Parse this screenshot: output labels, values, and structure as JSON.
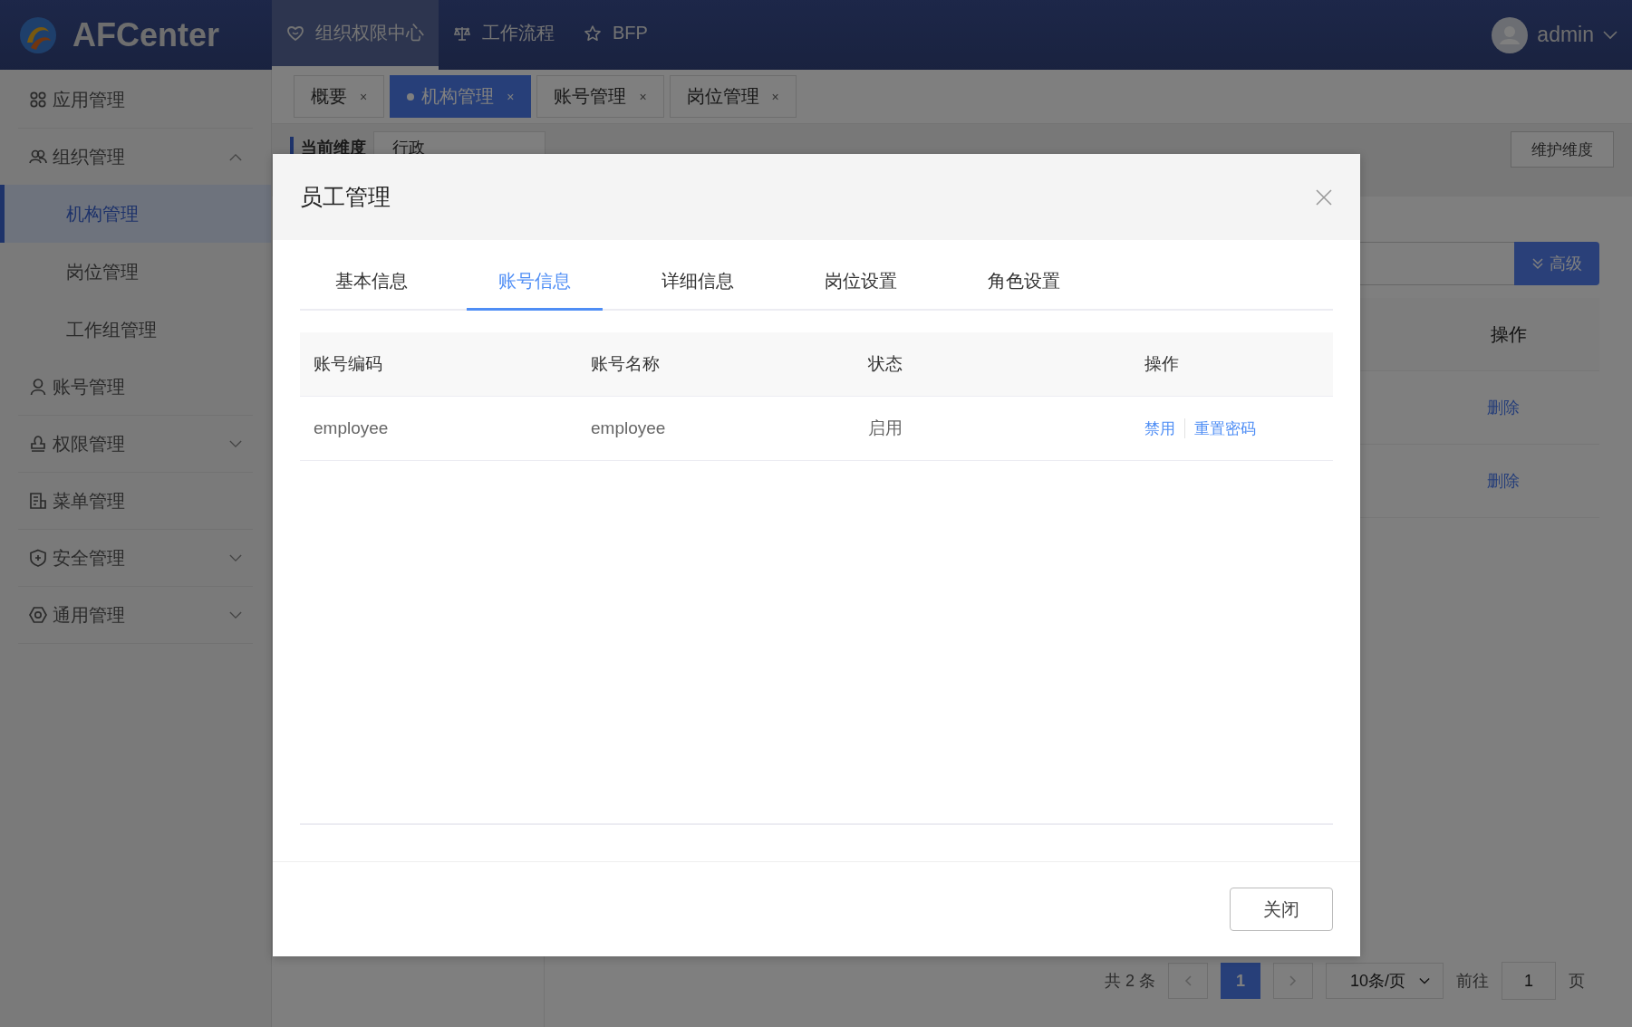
{
  "header": {
    "logo": "AFCenter",
    "nav": [
      {
        "label": "组织权限中心",
        "selected": true
      },
      {
        "label": "工作流程",
        "selected": false
      },
      {
        "label": "BFP",
        "selected": false
      }
    ],
    "user": "admin"
  },
  "sidebar": {
    "items": [
      {
        "label": "应用管理"
      },
      {
        "label": "组织管理",
        "expanded": true,
        "children": [
          {
            "label": "机构管理",
            "selected": true
          },
          {
            "label": "岗位管理",
            "selected": false
          },
          {
            "label": "工作组管理",
            "selected": false
          }
        ]
      },
      {
        "label": "账号管理"
      },
      {
        "label": "权限管理",
        "expanded": false
      },
      {
        "label": "菜单管理"
      },
      {
        "label": "安全管理",
        "expanded": false
      },
      {
        "label": "通用管理",
        "expanded": false
      }
    ]
  },
  "tabs": [
    {
      "label": "概要",
      "close": "×",
      "selected": false
    },
    {
      "label": "机构管理",
      "close": "×",
      "selected": true
    },
    {
      "label": "账号管理",
      "close": "×",
      "selected": false
    },
    {
      "label": "岗位管理",
      "close": "×",
      "selected": false
    }
  ],
  "filter": {
    "label": "当前维度",
    "value": "行政",
    "button": "维护维度"
  },
  "search": {
    "button": "高级"
  },
  "table": {
    "columns": [
      "操作"
    ],
    "rows": [
      {
        "action": "删除"
      },
      {
        "action": "删除"
      }
    ]
  },
  "pagination": {
    "total": "共 2 条",
    "pages": [
      {
        "label": "1",
        "selected": true
      }
    ],
    "page_size": "10条/页",
    "goto_label": "前往",
    "goto_value": "1",
    "page_suffix": "页"
  },
  "dialog": {
    "title": "员工管理",
    "tabs": [
      {
        "label": "基本信息",
        "selected": false
      },
      {
        "label": "账号信息",
        "selected": true
      },
      {
        "label": "详细信息",
        "selected": false
      },
      {
        "label": "岗位设置",
        "selected": false
      },
      {
        "label": "角色设置",
        "selected": false
      }
    ],
    "columns": [
      "账号编码",
      "账号名称",
      "状态",
      "操作"
    ],
    "rows": [
      {
        "code": "employee",
        "name": "employee",
        "status": "启用",
        "actions": [
          "禁用",
          "重置密码"
        ]
      }
    ],
    "close_button": "关闭"
  }
}
